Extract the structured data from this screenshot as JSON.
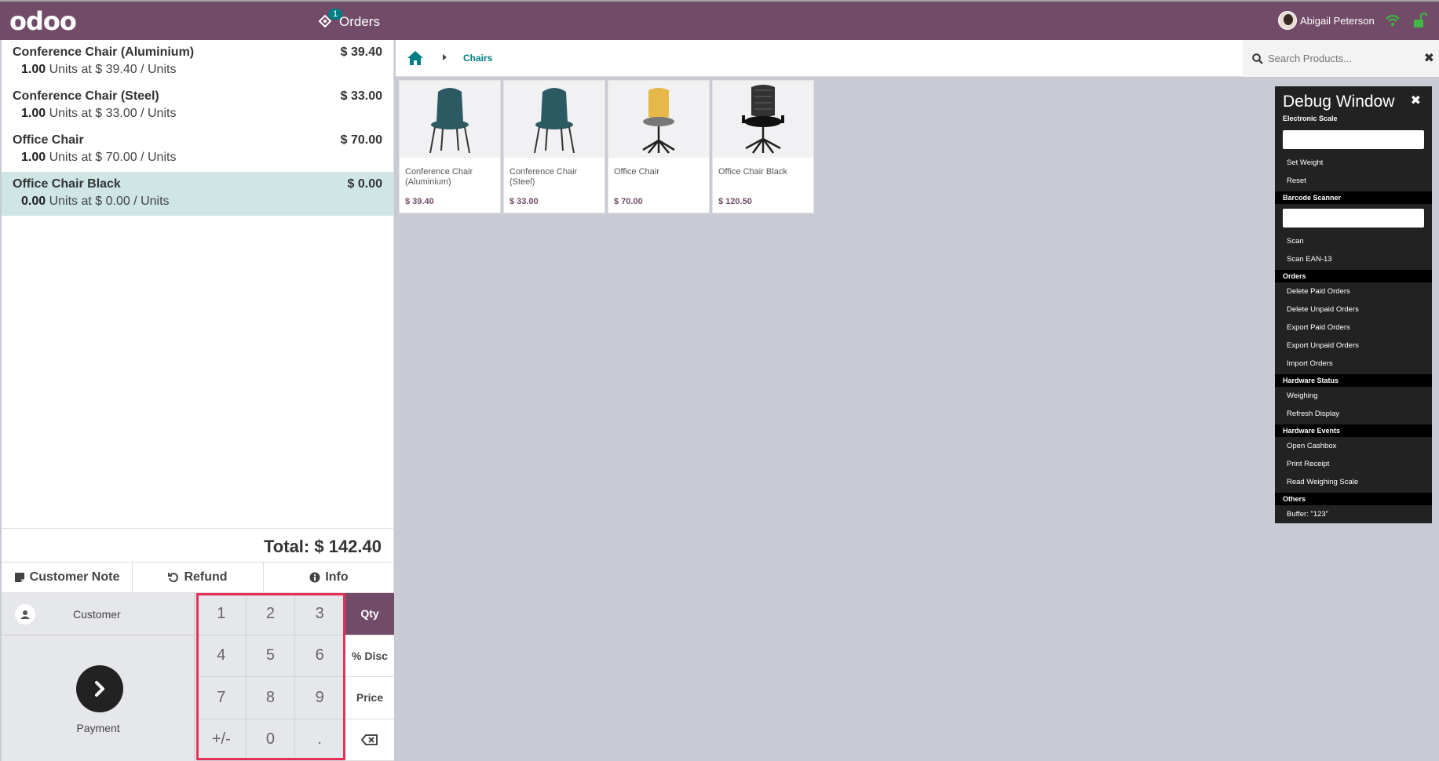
{
  "header": {
    "logo": "odoo",
    "orders_label": "Orders",
    "orders_count": "1",
    "user_name": "Abigail Peterson"
  },
  "order": {
    "lines": [
      {
        "name": "Conference Chair (Aluminium)",
        "price": "$ 39.40",
        "qty": "1.00",
        "detail": " Units at $ 39.40 / Units"
      },
      {
        "name": "Conference Chair (Steel)",
        "price": "$ 33.00",
        "qty": "1.00",
        "detail": " Units at $ 33.00 / Units"
      },
      {
        "name": "Office Chair",
        "price": "$ 70.00",
        "qty": "1.00",
        "detail": " Units at $ 70.00 / Units"
      },
      {
        "name": "Office Chair Black",
        "price": "$ 0.00",
        "qty": "0.00",
        "detail": " Units at $ 0.00 / Units"
      }
    ],
    "total": "Total: $ 142.40"
  },
  "controls": {
    "customer_note": "Customer Note",
    "refund": "Refund",
    "info": "Info",
    "customer": "Customer",
    "payment": "Payment"
  },
  "numpad": {
    "keys": [
      "1",
      "2",
      "3",
      "4",
      "5",
      "6",
      "7",
      "8",
      "9",
      "+/-",
      "0",
      "."
    ],
    "modes": [
      "Qty",
      "% Disc",
      "Price"
    ]
  },
  "breadcrumb": {
    "category": "Chairs"
  },
  "search": {
    "placeholder": "Search Products..."
  },
  "products": [
    {
      "name": "Conference Chair (Aluminium)",
      "price": "$ 39.40"
    },
    {
      "name": "Conference Chair (Steel)",
      "price": "$ 33.00"
    },
    {
      "name": "Office Chair",
      "price": "$ 70.00"
    },
    {
      "name": "Office Chair Black",
      "price": "$ 120.50"
    }
  ],
  "debug": {
    "title": "Debug Window",
    "scale_section": "Electronic Scale",
    "set_weight": "Set Weight",
    "reset": "Reset",
    "barcode_section": "Barcode Scanner",
    "scan": "Scan",
    "scan_ean": "Scan EAN-13",
    "orders_section": "Orders",
    "delete_paid": "Delete Paid Orders",
    "delete_unpaid": "Delete Unpaid Orders",
    "export_paid": "Export Paid Orders",
    "export_unpaid": "Export Unpaid Orders",
    "import_orders": "Import Orders",
    "hw_status_section": "Hardware Status",
    "weighing": "Weighing",
    "refresh_display": "Refresh Display",
    "hw_events_section": "Hardware Events",
    "open_cashbox": "Open Cashbox",
    "print_receipt": "Print Receipt",
    "read_scale": "Read Weighing Scale",
    "others_section": "Others",
    "buffer": "Buffer: \"123\""
  },
  "colors": {
    "brand": "#714b67",
    "accent": "#017e84",
    "selected_line": "#cfe5e6",
    "highlight_box": "#e5315a"
  }
}
